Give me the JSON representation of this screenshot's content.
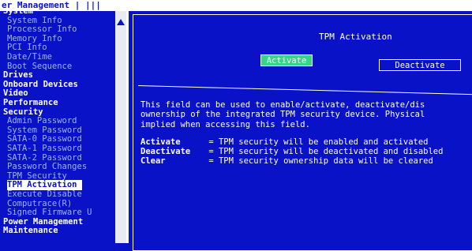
{
  "header": {
    "title": "er Management  | |||"
  },
  "sidebar": {
    "items": [
      {
        "label": "System",
        "kind": "cat"
      },
      {
        "label": "System Info",
        "kind": "sub"
      },
      {
        "label": "Processor Info",
        "kind": "sub"
      },
      {
        "label": "Memory Info",
        "kind": "sub"
      },
      {
        "label": "PCI Info",
        "kind": "sub"
      },
      {
        "label": "Date/Time",
        "kind": "sub"
      },
      {
        "label": "Boot Sequence",
        "kind": "sub"
      },
      {
        "label": "Drives",
        "kind": "cat"
      },
      {
        "label": "Onboard Devices",
        "kind": "cat"
      },
      {
        "label": "Video",
        "kind": "cat"
      },
      {
        "label": "Performance",
        "kind": "cat"
      },
      {
        "label": "Security",
        "kind": "cat"
      },
      {
        "label": "Admin Password",
        "kind": "sub"
      },
      {
        "label": "System Password",
        "kind": "sub"
      },
      {
        "label": "SATA-0 Password",
        "kind": "sub"
      },
      {
        "label": "SATA-1 Password",
        "kind": "sub"
      },
      {
        "label": "SATA-2 Password",
        "kind": "sub"
      },
      {
        "label": "Password Changes",
        "kind": "sub"
      },
      {
        "label": "TPM Security",
        "kind": "sub"
      },
      {
        "label": "TPM Activation",
        "kind": "sub",
        "selected": true
      },
      {
        "label": "Execute Disable",
        "kind": "sub"
      },
      {
        "label": "Computrace(R)",
        "kind": "sub"
      },
      {
        "label": "Signed Firmware U",
        "kind": "sub"
      },
      {
        "label": "Power Management",
        "kind": "cat"
      },
      {
        "label": "Maintenance",
        "kind": "cat"
      }
    ]
  },
  "panel": {
    "title": "TPM Activation",
    "activate_label": "Activate",
    "deactivate_label": "Deactivate",
    "help_lines": [
      "This field can be used to enable/activate, deactivate/dis",
      "ownership of the integrated TPM security device.  Physical",
      "implied when accessing this field."
    ],
    "options": [
      {
        "term": "Activate",
        "desc": "= TPM security will be enabled and activated"
      },
      {
        "term": "Deactivate",
        "desc": "= TPM security will be deactivated and disabled"
      },
      {
        "term": "Clear",
        "desc": "= TPM security ownership data will be cleared"
      }
    ]
  },
  "colors": {
    "background": "#0a12c8",
    "selected_bg": "#ffffff",
    "activate_button": "#35d68a",
    "category_text": "#ffffff",
    "item_text": "#9cb6ff"
  },
  "icons": {
    "scroll_up": "scroll-up-arrow-icon"
  }
}
